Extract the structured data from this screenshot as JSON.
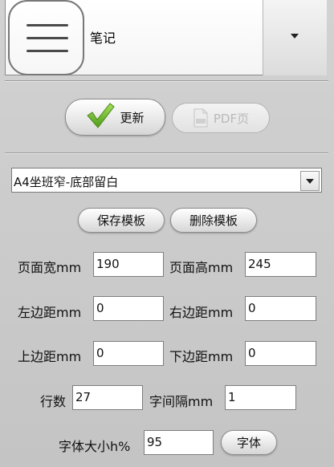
{
  "top_select": {
    "label": "笔记"
  },
  "actions": {
    "update_label": "更新",
    "pdf_label": "PDF页"
  },
  "template_select": {
    "value": "A4坐班窄-底部留白"
  },
  "template_buttons": {
    "save_label": "保存模板",
    "delete_label": "删除模板"
  },
  "fields": {
    "page_width": {
      "label": "页面宽mm",
      "value": "190"
    },
    "page_height": {
      "label": "页面高mm",
      "value": "245"
    },
    "left_margin": {
      "label": "左边距mm",
      "value": "0"
    },
    "right_margin": {
      "label": "右边距mm",
      "value": "0"
    },
    "top_margin": {
      "label": "上边距mm",
      "value": "0"
    },
    "bottom_margin": {
      "label": "下边距mm",
      "value": "0"
    },
    "rows": {
      "label": "行数",
      "value": "27"
    },
    "char_spacing": {
      "label": "字间隔mm",
      "value": "1"
    },
    "font_size": {
      "label": "字体大小h%",
      "value": "95"
    }
  },
  "font_button": {
    "label": "字体"
  },
  "colors": {
    "check_green": "#6ab02c",
    "panel_bg": "#cbcbcb",
    "disabled_text": "#b9b9b9"
  },
  "icons": {
    "menu": "hamburger-icon",
    "dropdown": "triangle-down-icon",
    "update": "checkmark-icon",
    "pdf": "document-icon"
  }
}
